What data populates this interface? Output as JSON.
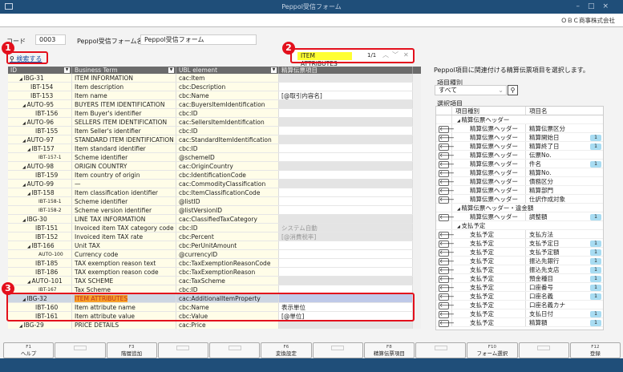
{
  "window": {
    "title": "Peppol受信フォーム",
    "company": "ＯＢＣ商事株式会社"
  },
  "form": {
    "code_label": "コード",
    "code_value": "0003",
    "name_label": "Peppol受信フォーム名",
    "name_value": "Peppol受信フォーム",
    "search_link": "検索する"
  },
  "find": {
    "query": "ITEM ATTRIBUTES",
    "count": "1/1"
  },
  "annotations": [
    "1",
    "2",
    "3"
  ],
  "grid": {
    "headers": [
      "ID",
      "Business Term",
      "UBL element",
      "精算伝票項目"
    ],
    "rows": [
      {
        "id": "IBG-31",
        "lvl": 0,
        "g": 1,
        "term": "ITEM INFORMATION",
        "ubl": "cac:Item",
        "map": ""
      },
      {
        "id": "IBT-154",
        "lvl": 1,
        "term": "Item description",
        "ubl": "cbc:Description",
        "map": ""
      },
      {
        "id": "IBT-153",
        "lvl": 1,
        "term": "Item name",
        "ubl": "cbc:Name",
        "map": "[@取引内容名]"
      },
      {
        "id": "AUTO-95",
        "lvl": 1,
        "g": 1,
        "term": "BUYERS ITEM IDENTIFICATION",
        "ubl": "cac:BuyersItemIdentification",
        "map": ""
      },
      {
        "id": "IBT-156",
        "lvl": 2,
        "term": "Item Buyer's identifier",
        "ubl": "cbc:ID",
        "map": ""
      },
      {
        "id": "AUTO-96",
        "lvl": 1,
        "g": 1,
        "term": "SELLERS ITEM IDENTIFICATION",
        "ubl": "cac:SellersItemIdentification",
        "map": ""
      },
      {
        "id": "IBT-155",
        "lvl": 2,
        "term": "Item Seller's identifier",
        "ubl": "cbc:ID",
        "map": ""
      },
      {
        "id": "AUTO-97",
        "lvl": 1,
        "g": 1,
        "term": "STANDARD ITEM IDENTIFICATION",
        "ubl": "cac:StandardItemIdentification",
        "map": ""
      },
      {
        "id": "IBT-157",
        "lvl": 2,
        "g": 0,
        "exp": 1,
        "term": "Item standard identifier",
        "ubl": "cbc:ID",
        "map": ""
      },
      {
        "id": "IBT-157-1",
        "lvl": 3,
        "small": 1,
        "term": "Scheme identifier",
        "ubl": "@schemeID",
        "map": ""
      },
      {
        "id": "AUTO-98",
        "lvl": 1,
        "g": 1,
        "term": "ORIGIN COUNTRY",
        "ubl": "cac:OriginCountry",
        "map": ""
      },
      {
        "id": "IBT-159",
        "lvl": 2,
        "term": "Item country of origin",
        "ubl": "cbc:IdentificationCode",
        "map": ""
      },
      {
        "id": "AUTO-99",
        "lvl": 1,
        "g": 1,
        "term": "—",
        "ubl": "cac:CommodityClassification",
        "map": ""
      },
      {
        "id": "IBT-158",
        "lvl": 2,
        "exp": 1,
        "term": "Item classification identifier",
        "ubl": "cbc:ItemClassificationCode",
        "map": ""
      },
      {
        "id": "IBT-158-1",
        "lvl": 3,
        "small": 1,
        "term": "Scheme identifier",
        "ubl": "@listID",
        "map": ""
      },
      {
        "id": "IBT-158-2",
        "lvl": 3,
        "small": 1,
        "term": "Scheme version identifier",
        "ubl": "@listVersionID",
        "map": ""
      },
      {
        "id": "IBG-30",
        "lvl": 1,
        "g": 1,
        "term": "LINE TAX INFORMATION",
        "ubl": "cac:ClassifiedTaxCategory",
        "map": ""
      },
      {
        "id": "IBT-151",
        "lvl": 2,
        "g": 1,
        "term": "Invoiced item TAX category code",
        "ubl": "cbc:ID",
        "map": "システム自動",
        "gray": 1
      },
      {
        "id": "IBT-152",
        "lvl": 2,
        "g": 1,
        "term": "Invoiced item TAX rate",
        "ubl": "cbc:Percent",
        "map": "[@消費税率]",
        "gray": 1
      },
      {
        "id": "IBT-166",
        "lvl": 2,
        "exp": 1,
        "term": "Unit TAX",
        "ubl": "cbc:PerUnitAmount",
        "map": ""
      },
      {
        "id": "AUTO-100",
        "lvl": 3,
        "small": 1,
        "term": "Currency code",
        "ubl": "@currencyID",
        "map": ""
      },
      {
        "id": "IBT-185",
        "lvl": 2,
        "term": "TAX exemption reason text",
        "ubl": "cbc:TaxExemptionReasonCode",
        "map": ""
      },
      {
        "id": "IBT-186",
        "lvl": 2,
        "term": "TAX exemption reason code",
        "ubl": "cbc:TaxExemptionReason",
        "map": ""
      },
      {
        "id": "AUTO-101",
        "lvl": 2,
        "g": 1,
        "exp": 1,
        "term": "TAX SCHEME",
        "ubl": "cac:TaxScheme",
        "map": ""
      },
      {
        "id": "IBT-167",
        "lvl": 3,
        "small": 1,
        "term": "Tax Scheme",
        "ubl": "cbc:ID",
        "map": ""
      },
      {
        "id": "IBG-32",
        "lvl": 1,
        "sel": 1,
        "hl": 1,
        "term": "ITEM ATTRIBUTES",
        "ubl": "cac:AdditionalItemProperty",
        "map": ""
      },
      {
        "id": "IBT-160",
        "lvl": 2,
        "term": "Item attribute name",
        "ubl": "cbc:Name",
        "map": "表示単位"
      },
      {
        "id": "IBT-161",
        "lvl": 2,
        "term": "Item attribute value",
        "ubl": "cbc:Value",
        "map": "[@単位]"
      },
      {
        "id": "IBG-29",
        "lvl": 0,
        "g": 1,
        "term": "PRICE DETAILS",
        "ubl": "cac:Price",
        "map": ""
      }
    ]
  },
  "right": {
    "description": "Peppol項目に関連付ける精算伝票項目を選択します。",
    "type_label": "項目種別",
    "type_value": "すべて",
    "list_label": "選択項目",
    "headers": [
      "項目種別",
      "項目名"
    ],
    "rows": [
      {
        "group": "精算伝票ヘッダー"
      },
      {
        "kind": "精算伝票ヘッダー",
        "name": "精算伝票区分",
        "badge": ""
      },
      {
        "kind": "精算伝票ヘッダー",
        "name": "精算開始日",
        "badge": "1"
      },
      {
        "kind": "精算伝票ヘッダー",
        "name": "精算終了日",
        "badge": "1"
      },
      {
        "kind": "精算伝票ヘッダー",
        "name": "伝票No.",
        "badge": ""
      },
      {
        "kind": "精算伝票ヘッダー",
        "name": "件名",
        "badge": "1"
      },
      {
        "kind": "精算伝票ヘッダー",
        "name": "精算No.",
        "badge": ""
      },
      {
        "kind": "精算伝票ヘッダー",
        "name": "債務区分",
        "badge": ""
      },
      {
        "kind": "精算伝票ヘッダー",
        "name": "精算部門",
        "badge": ""
      },
      {
        "kind": "精算伝票ヘッダー",
        "name": "仕訳作成対象",
        "badge": ""
      },
      {
        "group": "精算伝票ヘッダー・違金額"
      },
      {
        "kind": "精算伝票ヘッダー",
        "name": "調整額",
        "badge": "1"
      },
      {
        "group": "支払予定"
      },
      {
        "kind": "支払予定",
        "name": "支払方法",
        "badge": ""
      },
      {
        "kind": "支払予定",
        "name": "支払予定日",
        "badge": "1"
      },
      {
        "kind": "支払予定",
        "name": "支払予定額",
        "badge": "1"
      },
      {
        "kind": "支払予定",
        "name": "振込先銀行",
        "badge": "1"
      },
      {
        "kind": "支払予定",
        "name": "振込先支店",
        "badge": "1"
      },
      {
        "kind": "支払予定",
        "name": "預金種目",
        "badge": "1"
      },
      {
        "kind": "支払予定",
        "name": "口座番号",
        "badge": "1"
      },
      {
        "kind": "支払予定",
        "name": "口座名義",
        "badge": "1"
      },
      {
        "kind": "支払予定",
        "name": "口座名義カナ",
        "badge": ""
      },
      {
        "kind": "支払予定",
        "name": "支払日付",
        "badge": "1"
      },
      {
        "kind": "支払予定",
        "name": "精算額",
        "badge": "1"
      }
    ]
  },
  "fkeys": [
    {
      "key": "F1",
      "label": "ヘルプ"
    },
    {
      "key": "",
      "label": ""
    },
    {
      "key": "F3",
      "label": "階層追加"
    },
    {
      "key": "",
      "label": ""
    },
    {
      "key": "",
      "label": ""
    },
    {
      "key": "F6",
      "label": "変換設定"
    },
    {
      "key": "",
      "label": ""
    },
    {
      "key": "F8",
      "label": "精算伝票項目"
    },
    {
      "key": "",
      "label": ""
    },
    {
      "key": "F10",
      "label": "フォーム選択"
    },
    {
      "key": "",
      "label": ""
    },
    {
      "key": "F12",
      "label": "登録"
    }
  ]
}
